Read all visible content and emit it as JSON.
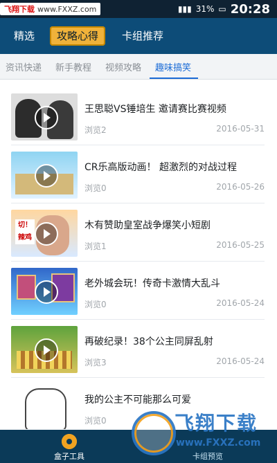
{
  "status_bar": {
    "watermark_brand": "飞翔下载",
    "watermark_site": "www.FXXZ.com",
    "battery": "31%",
    "time": "20:28"
  },
  "top_tabs": [
    {
      "label": "精选"
    },
    {
      "label": "攻略心得",
      "active": true
    },
    {
      "label": "卡组推荐"
    }
  ],
  "sub_tabs": [
    {
      "label": "资讯快递"
    },
    {
      "label": "新手教程"
    },
    {
      "label": "视频攻略"
    },
    {
      "label": "趣味搞笑",
      "active": true
    }
  ],
  "items": [
    {
      "title": "王思聪VS锤培生 邀请赛比赛视频",
      "views": "浏览2",
      "date": "2016-05-31"
    },
    {
      "title": "CR乐高版动画！ 超激烈的对战过程",
      "views": "浏览0",
      "date": "2016-05-26"
    },
    {
      "title": "木有赞助皇室战争爆笑小短剧",
      "views": "浏览1",
      "date": "2016-05-25",
      "thumb_text": "切！辣鸡"
    },
    {
      "title": "老外城会玩！传奇卡激情大乱斗",
      "views": "浏览0",
      "date": "2016-05-24"
    },
    {
      "title": "再破纪录！38个公主同屏乱射",
      "views": "浏览3",
      "date": "2016-05-24"
    },
    {
      "title": "我的公主不可能那么可爱",
      "views": "浏览0",
      "date": ""
    }
  ],
  "bottom_nav": [
    {
      "label": "盒子工具",
      "icon": "gear-icon"
    },
    {
      "label": "卡组预览"
    }
  ],
  "watermark_logo": {
    "title": "飞翔下载",
    "url": "www.FXXZ.com"
  },
  "colors": {
    "header_bg": "#0d4c78",
    "active_tab": "#f0b23a",
    "subtab_active": "#1b6bd6",
    "bottom_bar": "#0b3a58"
  }
}
